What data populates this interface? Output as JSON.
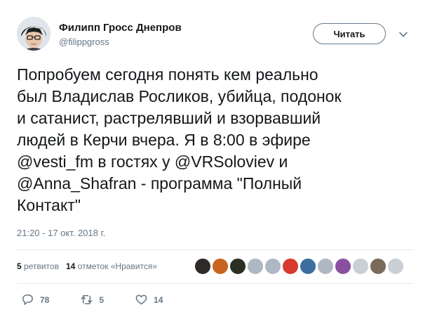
{
  "author": {
    "name": "Филипп Гросс Днепров",
    "handle": "@filippgross"
  },
  "follow_button": {
    "label": "Читать"
  },
  "tweet": {
    "lines": [
      "Попробуем сегодня понять кем реально",
      "был Владислав Росликов, убийца, подонок",
      "и сатанист, растрелявший и взорвавший",
      "людей в Керчи вчера. Я в 8:00 в эфире",
      "@vesti_fm в гостях у @VRSoloviev и",
      "@Anna_Shafran - программа \"Полный",
      "Контакт\""
    ],
    "timestamp": "21:20 - 17 окт. 2018 г."
  },
  "stats": {
    "retweets_count": "5",
    "retweets_label": "ретвитов",
    "likes_count": "14",
    "likes_label": "отметок «Нравится»"
  },
  "liker_avatars": [
    {
      "color": "#2f2a28"
    },
    {
      "color": "#c8641e"
    },
    {
      "color": "#2b2f24"
    },
    {
      "color": "#aeb8c2"
    },
    {
      "color": "#aeb8c2"
    },
    {
      "color": "#d63a2e"
    },
    {
      "color": "#3c6ea0"
    },
    {
      "color": "#aeb8c2"
    },
    {
      "color": "#8a4fa0"
    },
    {
      "color": "#c9cfd4"
    },
    {
      "color": "#7a6a5a"
    },
    {
      "color": "#c9cfd4"
    }
  ],
  "actions": {
    "reply_count": "78",
    "retweet_count": "5",
    "like_count": "14"
  },
  "colors": {
    "text": "#14171a",
    "secondary": "#657786",
    "divider": "#e6ecf0"
  }
}
